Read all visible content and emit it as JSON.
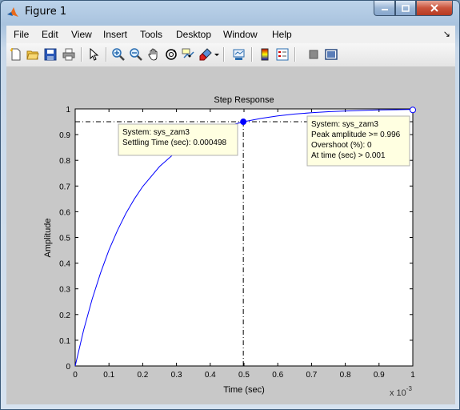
{
  "window": {
    "title": "Figure 1"
  },
  "menu": [
    "File",
    "Edit",
    "View",
    "Insert",
    "Tools",
    "Desktop",
    "Window",
    "Help"
  ],
  "toolbar": {
    "icons": [
      "new-figure-icon",
      "open-file-icon",
      "save-icon",
      "print-icon",
      "edit-plot-arrow-icon",
      "zoom-in-icon",
      "zoom-out-icon",
      "pan-hand-icon",
      "rotate-3d-icon",
      "data-cursor-icon",
      "brush-icon",
      "brush-dropdown-icon",
      "link-plot-icon",
      "insert-colorbar-icon",
      "insert-legend-icon",
      "hide-plot-tools-icon",
      "show-plot-tools-icon"
    ]
  },
  "colors": {
    "line": "#0000ff",
    "plot_bg": "#ffffff",
    "figure_bg": "#c8c8c8",
    "datatip_bg": "#ffffe1"
  },
  "chart_data": {
    "type": "line",
    "title": "Step Response",
    "xlabel": "Time (sec)",
    "ylabel": "Amplitude",
    "x_exponent": "x 10",
    "x_exponent_power": "-3",
    "xlim": [
      0,
      1
    ],
    "ylim": [
      0,
      1
    ],
    "x_scale_note": "x values in units of 1e-3 sec",
    "xticks": [
      "0",
      "0.1",
      "0.2",
      "0.3",
      "0.4",
      "0.5",
      "0.6",
      "0.7",
      "0.8",
      "0.9",
      "1"
    ],
    "yticks": [
      "0",
      "0.1",
      "0.2",
      "0.3",
      "0.4",
      "0.5",
      "0.6",
      "0.7",
      "0.8",
      "0.9",
      "1"
    ],
    "series": [
      {
        "x": [
          0,
          0.025,
          0.05,
          0.075,
          0.1,
          0.125,
          0.15,
          0.175,
          0.2,
          0.25,
          0.3,
          0.35,
          0.4,
          0.45,
          0.498,
          0.55,
          0.6,
          0.65,
          0.7,
          0.75,
          0.8,
          0.85,
          0.9,
          0.95,
          1.0
        ],
        "y": [
          0,
          0.139,
          0.259,
          0.362,
          0.451,
          0.527,
          0.593,
          0.649,
          0.698,
          0.776,
          0.834,
          0.877,
          0.909,
          0.933,
          0.95,
          0.963,
          0.973,
          0.98,
          0.985,
          0.989,
          0.992,
          0.994,
          0.996,
          0.997,
          0.998
        ]
      }
    ],
    "settling": {
      "x": 0.498,
      "y": 0.95
    },
    "peak": {
      "x": 1.0,
      "y": 0.996
    },
    "datatips": [
      {
        "lines": [
          "System: sys_zam3",
          "Settling Time (sec): 0.000498"
        ]
      },
      {
        "lines": [
          "System: sys_zam3",
          "Peak amplitude >= 0.996",
          "Overshoot (%): 0",
          "At time (sec) > 0.001"
        ]
      }
    ],
    "grid": false
  }
}
